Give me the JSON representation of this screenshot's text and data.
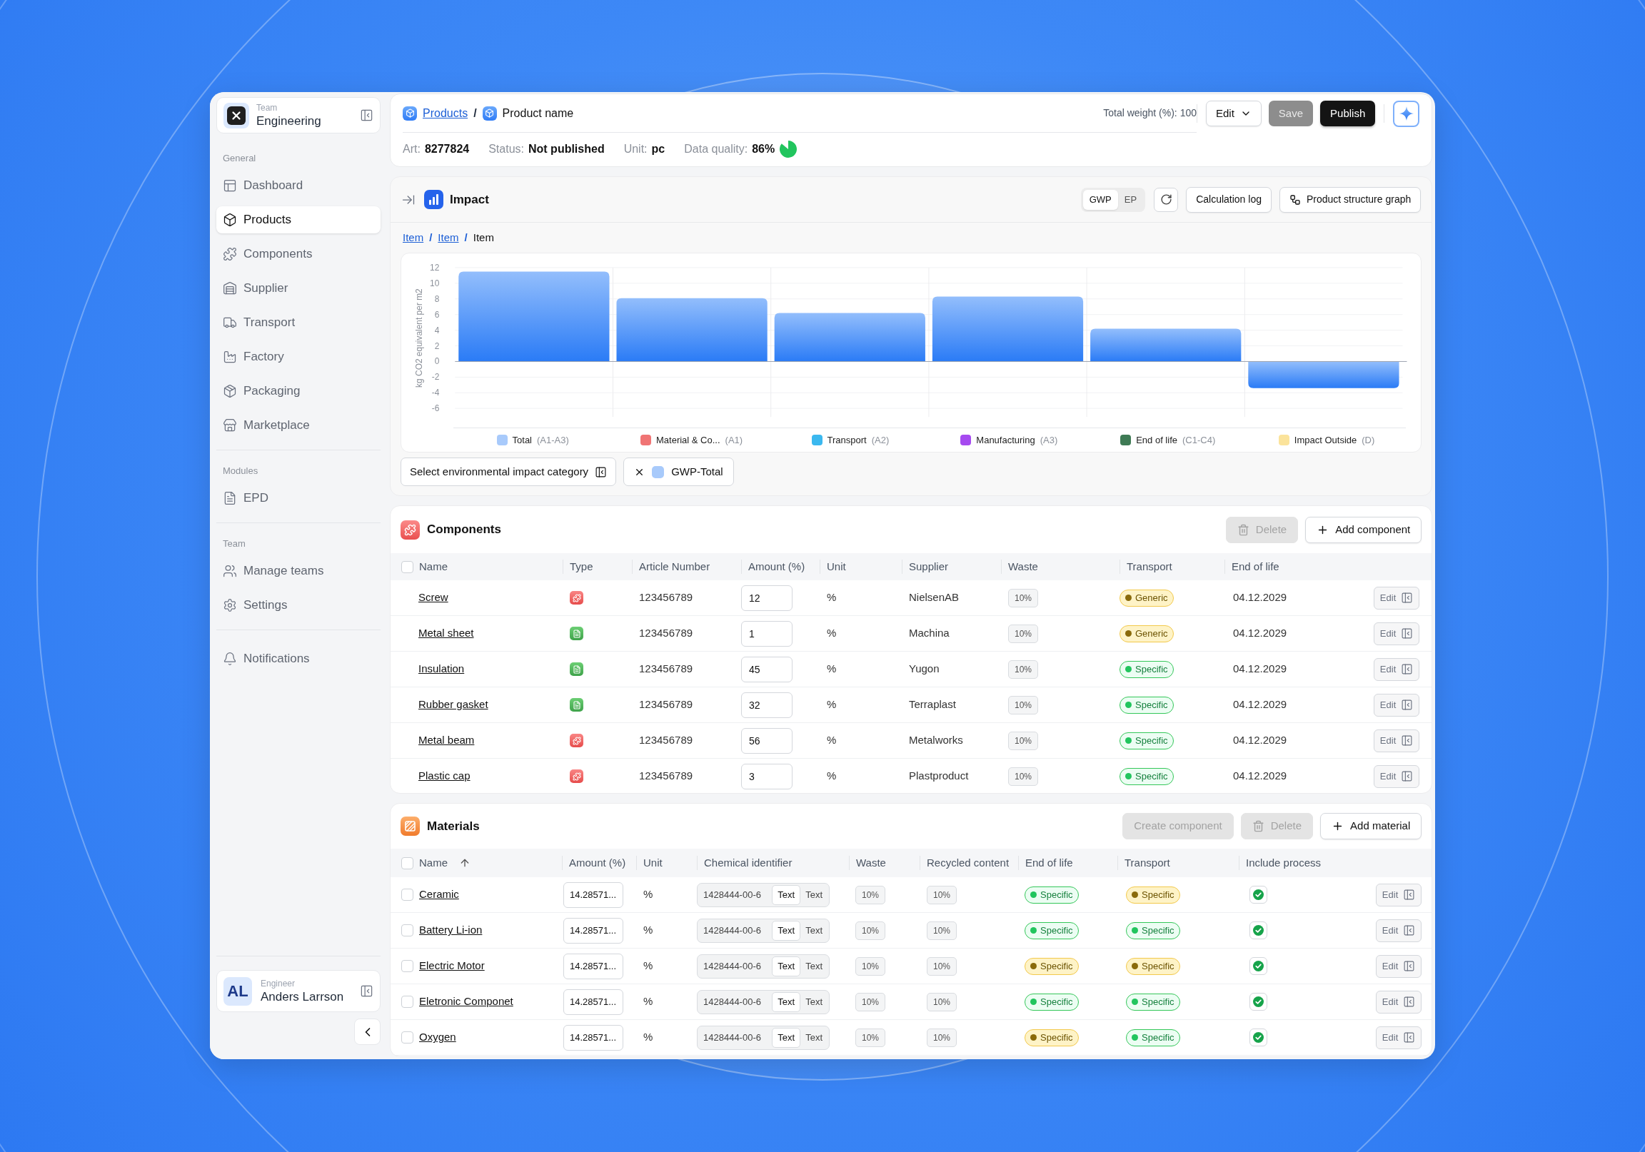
{
  "sidebar": {
    "team": {
      "caption": "Team",
      "name": "Engineering"
    },
    "sections": [
      {
        "title": "General",
        "items": [
          {
            "label": "Dashboard",
            "selected": false
          },
          {
            "label": "Products",
            "selected": true
          },
          {
            "label": "Components",
            "selected": false
          },
          {
            "label": "Supplier",
            "selected": false
          },
          {
            "label": "Transport",
            "selected": false
          },
          {
            "label": "Factory",
            "selected": false
          },
          {
            "label": "Packaging",
            "selected": false
          },
          {
            "label": "Marketplace",
            "selected": false
          }
        ]
      },
      {
        "title": "Modules",
        "items": [
          {
            "label": "EPD",
            "selected": false
          }
        ]
      },
      {
        "title": "Team",
        "items": [
          {
            "label": "Manage teams",
            "selected": false
          },
          {
            "label": "Settings",
            "selected": false
          }
        ]
      },
      {
        "items": [
          {
            "label": "Notifications",
            "selected": false
          }
        ]
      }
    ],
    "user": {
      "initials": "AL",
      "role": "Engineer",
      "name": "Anders Larrson"
    }
  },
  "header": {
    "breadcrumb": {
      "separator": "/",
      "items": [
        {
          "label": "Products",
          "link": true
        },
        {
          "label": "Product name",
          "link": false
        }
      ]
    },
    "total_weight": "Total weight (%): 100",
    "actions": [
      {
        "label": "Edit",
        "kind": "menu",
        "disabled": false
      },
      {
        "label": "Save",
        "kind": "primary",
        "disabled": true
      },
      {
        "label": "Publish",
        "kind": "primary",
        "disabled": false
      }
    ],
    "meta": [
      {
        "label": "Art:",
        "value": "8277824"
      },
      {
        "label": "Status:",
        "value": "Not published"
      },
      {
        "label": "Unit:",
        "value": "pc"
      },
      {
        "label": "Data quality:",
        "value": "86%",
        "level": 0.86
      }
    ]
  },
  "impact": {
    "title": "Impact",
    "toggle": [
      {
        "label": "GWP",
        "selected": true
      },
      {
        "label": "EP",
        "selected": false
      }
    ],
    "buttons": [
      {
        "label": "Calculation log",
        "kind": "plain"
      },
      {
        "label": "Product structure graph",
        "kind": "graph"
      }
    ],
    "breadcrumb": {
      "separator": "/",
      "items": [
        {
          "label": "Item",
          "link": true
        },
        {
          "label": "Item",
          "link": true
        },
        {
          "label": "Item",
          "link": false
        }
      ]
    },
    "chart_data": {
      "type": "bar",
      "ylabel": "kg CO2 equivalent per m2",
      "categories": [
        "Total",
        "Material & Co...",
        "Transport",
        "Manufacturing",
        "End of life",
        "Impact Outside"
      ],
      "values": [
        11.5,
        8.1,
        6.2,
        8.3,
        4.2,
        -3.4
      ],
      "ylim": [
        -6,
        12
      ],
      "yticks": [
        12,
        10,
        8,
        6,
        4,
        2,
        0,
        -2,
        -4,
        -6
      ],
      "grid": true
    },
    "legend": [
      {
        "code": "(A1-A3)",
        "color": "#a8cafb"
      },
      {
        "code": "(A1)",
        "color": "#f07474"
      },
      {
        "code": "(A2)",
        "color": "#3bb8ef"
      },
      {
        "code": "(A3)",
        "color": "#a64af0"
      },
      {
        "code": "(C1-C4)",
        "color": "#3e7a54"
      },
      {
        "code": "(D)",
        "color": "#fbe39b"
      }
    ],
    "category_button": "Select environmental impact category",
    "filters": [
      {
        "label": "GWP-Total",
        "color": "#a8cafb"
      }
    ]
  },
  "components": {
    "title": "Components",
    "actions": [
      {
        "label": "Delete",
        "kind": "delete",
        "disabled": true
      },
      {
        "label": "Add component",
        "kind": "add",
        "disabled": false
      }
    ],
    "select_all": false,
    "columns": [
      {
        "label": "Name"
      },
      {
        "label": "Type"
      },
      {
        "label": "Article Number"
      },
      {
        "label": "Amount (%)"
      },
      {
        "label": "Unit"
      },
      {
        "label": "Supplier"
      },
      {
        "label": "Waste"
      },
      {
        "label": "Transport"
      },
      {
        "label": "End of life"
      }
    ],
    "rows": [
      {
        "name": "Screw",
        "kind": "component",
        "article": "123456789",
        "amount": "12",
        "unit": "%",
        "supplier": "NielsenAB",
        "waste": "10%",
        "transport": {
          "label": "Generic",
          "kind": "warning"
        },
        "end_of_life": "04.12.2029",
        "edit": "Edit"
      },
      {
        "name": "Metal sheet",
        "kind": "document",
        "article": "123456789",
        "amount": "1",
        "unit": "%",
        "supplier": "Machina",
        "waste": "10%",
        "transport": {
          "label": "Generic",
          "kind": "warning"
        },
        "end_of_life": "04.12.2029",
        "edit": "Edit"
      },
      {
        "name": "Insulation",
        "kind": "document",
        "article": "123456789",
        "amount": "45",
        "unit": "%",
        "supplier": "Yugon",
        "waste": "10%",
        "transport": {
          "label": "Specific",
          "kind": "success"
        },
        "end_of_life": "04.12.2029",
        "edit": "Edit"
      },
      {
        "name": "Rubber gasket",
        "kind": "document",
        "article": "123456789",
        "amount": "32",
        "unit": "%",
        "supplier": "Terraplast",
        "waste": "10%",
        "transport": {
          "label": "Specific",
          "kind": "success"
        },
        "end_of_life": "04.12.2029",
        "edit": "Edit"
      },
      {
        "name": "Metal beam",
        "kind": "component",
        "article": "123456789",
        "amount": "56",
        "unit": "%",
        "supplier": "Metalworks",
        "waste": "10%",
        "transport": {
          "label": "Specific",
          "kind": "success"
        },
        "end_of_life": "04.12.2029",
        "edit": "Edit"
      },
      {
        "name": "Plastic cap",
        "kind": "component",
        "article": "123456789",
        "amount": "3",
        "unit": "%",
        "supplier": "Plastproduct",
        "waste": "10%",
        "transport": {
          "label": "Specific",
          "kind": "success"
        },
        "end_of_life": "04.12.2029",
        "edit": "Edit"
      }
    ]
  },
  "materials": {
    "title": "Materials",
    "actions": [
      {
        "label": "Create component",
        "kind": "plain",
        "disabled": true
      },
      {
        "label": "Delete",
        "kind": "delete",
        "disabled": true
      },
      {
        "label": "Add material",
        "kind": "add",
        "disabled": false
      }
    ],
    "select_all": false,
    "columns": [
      {
        "label": "Name",
        "sorted": true
      },
      {
        "label": "Amount (%)"
      },
      {
        "label": "Unit"
      },
      {
        "label": "Chemical identifier"
      },
      {
        "label": "Waste"
      },
      {
        "label": "Recycled content"
      },
      {
        "label": "End of life"
      },
      {
        "label": "Transport"
      },
      {
        "label": "Include process"
      }
    ],
    "rows": [
      {
        "name": "Ceramic",
        "checked": false,
        "amount": "14.28571...",
        "unit": "%",
        "chemical_id": "1428444-00-6",
        "formats": [
          {
            "label": "Text",
            "selected": true
          },
          {
            "label": "Text",
            "selected": false
          }
        ],
        "waste": "10%",
        "recycled": "10%",
        "end_of_life": {
          "label": "Specific",
          "kind": "success"
        },
        "transport": {
          "label": "Specific",
          "kind": "warning"
        },
        "include_process": true,
        "edit": "Edit"
      },
      {
        "name": "Battery Li-ion",
        "checked": false,
        "amount": "14.28571...",
        "unit": "%",
        "chemical_id": "1428444-00-6",
        "formats": [
          {
            "label": "Text",
            "selected": true
          },
          {
            "label": "Text",
            "selected": false
          }
        ],
        "waste": "10%",
        "recycled": "10%",
        "end_of_life": {
          "label": "Specific",
          "kind": "success"
        },
        "transport": {
          "label": "Specific",
          "kind": "success"
        },
        "include_process": true,
        "edit": "Edit"
      },
      {
        "name": "Electric Motor",
        "checked": false,
        "amount": "14.28571...",
        "unit": "%",
        "chemical_id": "1428444-00-6",
        "formats": [
          {
            "label": "Text",
            "selected": true
          },
          {
            "label": "Text",
            "selected": false
          }
        ],
        "waste": "10%",
        "recycled": "10%",
        "end_of_life": {
          "label": "Specific",
          "kind": "warning"
        },
        "transport": {
          "label": "Specific",
          "kind": "warning"
        },
        "include_process": true,
        "edit": "Edit"
      },
      {
        "name": "Eletronic Componet",
        "checked": false,
        "amount": "14.28571...",
        "unit": "%",
        "chemical_id": "1428444-00-6",
        "formats": [
          {
            "label": "Text",
            "selected": true
          },
          {
            "label": "Text",
            "selected": false
          }
        ],
        "waste": "10%",
        "recycled": "10%",
        "end_of_life": {
          "label": "Specific",
          "kind": "success"
        },
        "transport": {
          "label": "Specific",
          "kind": "success"
        },
        "include_process": true,
        "edit": "Edit"
      },
      {
        "name": "Oxygen",
        "checked": false,
        "amount": "14.28571...",
        "unit": "%",
        "chemical_id": "1428444-00-6",
        "formats": [
          {
            "label": "Text",
            "selected": true
          },
          {
            "label": "Text",
            "selected": false
          }
        ],
        "waste": "10%",
        "recycled": "10%",
        "end_of_life": {
          "label": "Specific",
          "kind": "warning"
        },
        "transport": {
          "label": "Specific",
          "kind": "success"
        },
        "include_process": true,
        "edit": "Edit"
      }
    ]
  }
}
